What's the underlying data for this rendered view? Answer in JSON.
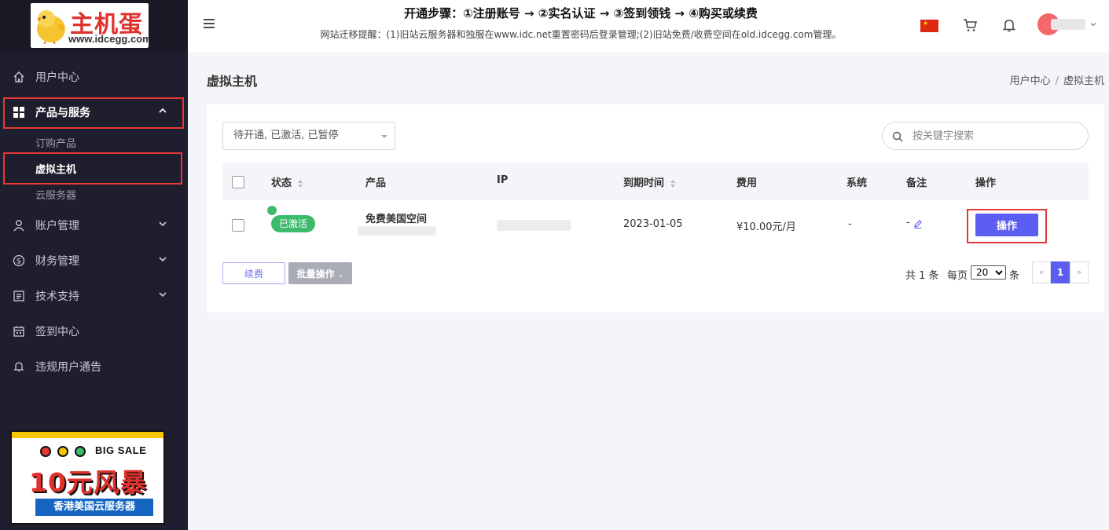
{
  "sidebar": {
    "logo": {
      "brand": "主机蛋",
      "domain": "www.idcegg.com"
    },
    "nav": {
      "user_center": "用户中心",
      "products": "产品与服务",
      "sub_order": "订购产品",
      "sub_vhost": "虚拟主机",
      "sub_cloud": "云服务器",
      "account": "账户管理",
      "finance": "财务管理",
      "support": "技术支持",
      "checkin": "签到中心",
      "violation": "违规用户通告"
    },
    "promo": {
      "bigsale": "BIG SALE",
      "headline": "10元风暴",
      "sub": "香港美国云服务器"
    }
  },
  "header": {
    "notice_title": "开通步骤：①注册账号 → ②实名认证 → ③签到领钱 → ④购买或续费",
    "notice_text": "网站迁移提醒：(1)旧站云服务器和独服在www.idc.net重置密码后登录管理;(2)旧站免费/收费空间在old.idcegg.com管理。"
  },
  "main": {
    "page_title": "虚拟主机",
    "breadcrumb": {
      "home": "用户中心",
      "sep": "/",
      "current": "虚拟主机"
    },
    "filter_value": "待开通, 已激活, 已暂停",
    "search_placeholder": "按关键字搜索",
    "columns": {
      "status": "状态",
      "product": "产品",
      "ip": "IP",
      "expire": "到期时间",
      "fee": "费用",
      "system": "系统",
      "note": "备注",
      "action": "操作"
    },
    "rows": [
      {
        "status": "已激活",
        "product": "免费美国空间",
        "expire": "2023-01-05",
        "fee": "¥10.00元/月",
        "system": "-",
        "note": "-",
        "action": "操作"
      }
    ],
    "renew_label": "续费",
    "batch_label": "批量操作",
    "pager": {
      "total": "共 1 条",
      "per_page_label": "每页",
      "per_page_value": "20",
      "per_page_unit": "条",
      "prev": "«",
      "current": "1",
      "next": "»"
    }
  },
  "colors": {
    "accent": "#5b5ef1",
    "active_green": "#3dbb6b",
    "highlight_red": "#e53935",
    "sidebar_bg": "#1f1e2e"
  }
}
